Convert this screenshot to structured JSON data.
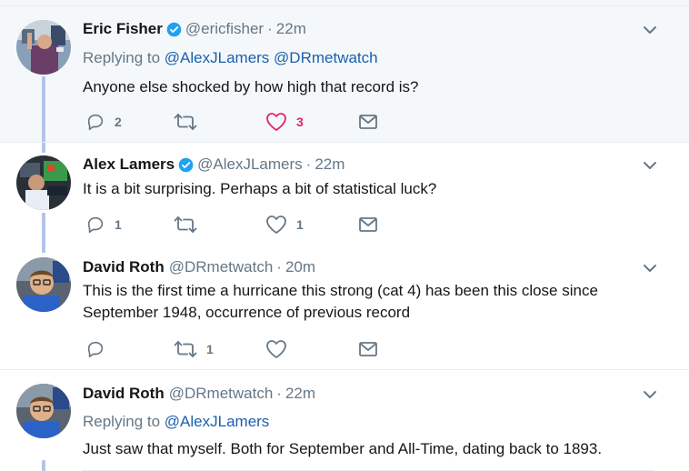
{
  "tweets": [
    {
      "name": "Eric Fisher",
      "verified": true,
      "handle": "@ericfisher",
      "separator": "·",
      "time": "22m",
      "replying_prefix": "Replying to",
      "replying_to": [
        "@AlexJLamers",
        "@DRmetwatch"
      ],
      "text": "Anyone else shocked by how high that record is?",
      "reply_count": "2",
      "retweet_count": "",
      "like_count": "3",
      "liked": true
    },
    {
      "name": "Alex Lamers",
      "verified": true,
      "handle": "@AlexJLamers",
      "separator": "·",
      "time": "22m",
      "text": "It is a bit surprising. Perhaps a bit of statistical luck?",
      "reply_count": "1",
      "retweet_count": "",
      "like_count": "1",
      "liked": false
    },
    {
      "name": "David Roth",
      "verified": false,
      "handle": "@DRmetwatch",
      "separator": "·",
      "time": "20m",
      "text_line1": "This is the first time a hurricane this strong (cat 4) has been this close since",
      "text_line2": "September 1948, occurrence of previous record",
      "reply_count": "",
      "retweet_count": "1",
      "like_count": "",
      "liked": false
    },
    {
      "name": "David Roth",
      "verified": false,
      "handle": "@DRmetwatch",
      "separator": "·",
      "time": "22m",
      "replying_prefix": "Replying to",
      "replying_to": [
        "@AlexJLamers"
      ],
      "text": "Just saw that myself.  Both for September and All-Time, dating back to 1893."
    }
  ],
  "colors": {
    "highlight_bg": "#f5f8fa",
    "thread_line": "#b3c4e6",
    "link": "#1b5fae",
    "muted": "#657786",
    "like": "#e0245e",
    "verified": "#1da1f2"
  },
  "icons": [
    "reply-icon",
    "retweet-icon",
    "like-icon",
    "direct-message-icon",
    "caret-down-icon",
    "verified-badge-icon"
  ]
}
